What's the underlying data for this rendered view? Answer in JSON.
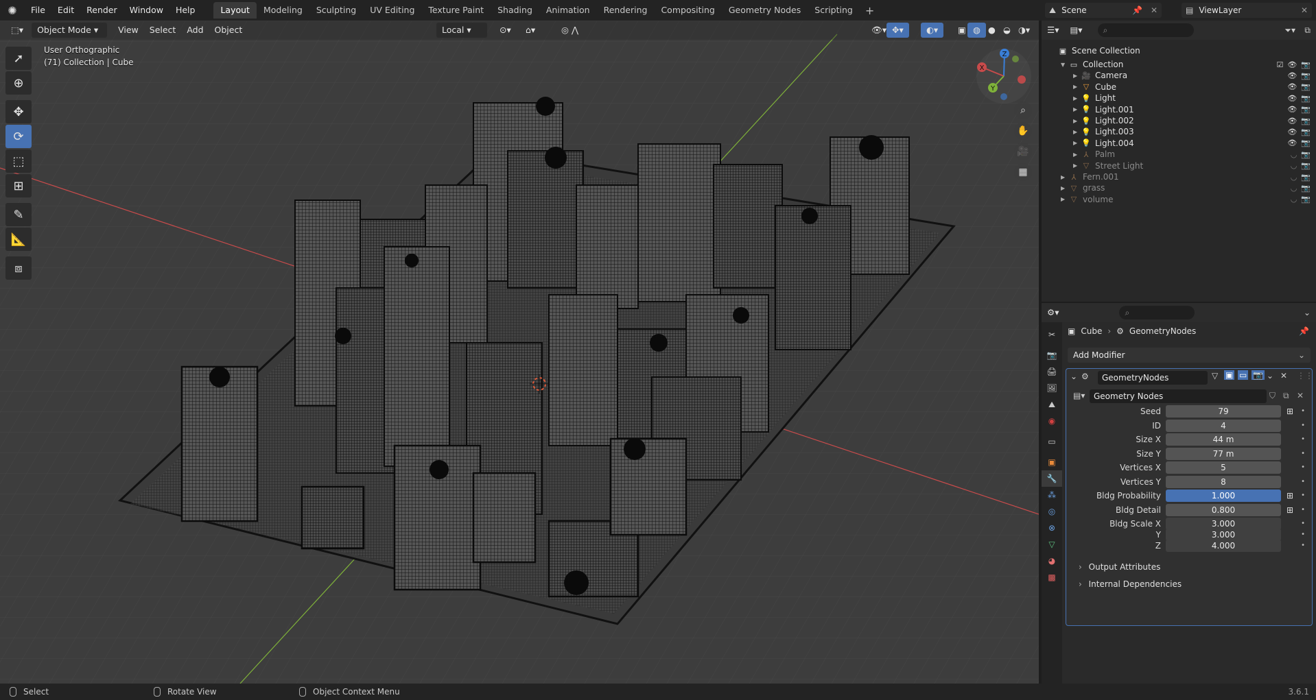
{
  "menu": {
    "items": [
      "File",
      "Edit",
      "Render",
      "Window",
      "Help"
    ]
  },
  "workspaces": {
    "tabs": [
      "Layout",
      "Modeling",
      "Sculpting",
      "UV Editing",
      "Texture Paint",
      "Shading",
      "Animation",
      "Rendering",
      "Compositing",
      "Geometry Nodes",
      "Scripting"
    ],
    "active": "Layout"
  },
  "scene": {
    "name": "Scene",
    "view_layer": "ViewLayer"
  },
  "viewport": {
    "mode": "Object Mode",
    "menus": [
      "View",
      "Select",
      "Add",
      "Object"
    ],
    "transform_orientation": "Local",
    "view_name": "User Orthographic",
    "collection_info": "(71) Collection | Cube",
    "gizmo_axes": {
      "x": "X",
      "y": "Y",
      "z": "Z"
    }
  },
  "outliner": {
    "root": "Scene Collection",
    "rows": [
      {
        "name": "Collection",
        "indent": 1,
        "icon": "collection-icon",
        "color": "#e0e0e0",
        "dim": false
      },
      {
        "name": "Camera",
        "indent": 2,
        "icon": "camera-icon",
        "color": "#e0e0e0",
        "dim": false
      },
      {
        "name": "Cube",
        "indent": 2,
        "icon": "mesh-icon",
        "color": "#e0e0e0",
        "dim": false
      },
      {
        "name": "Light",
        "indent": 2,
        "icon": "light-icon",
        "color": "#e0e0e0",
        "dim": false
      },
      {
        "name": "Light.001",
        "indent": 2,
        "icon": "light-icon",
        "color": "#e0e0e0",
        "dim": false
      },
      {
        "name": "Light.002",
        "indent": 2,
        "icon": "light-icon",
        "color": "#e0e0e0",
        "dim": false
      },
      {
        "name": "Light.003",
        "indent": 2,
        "icon": "light-icon",
        "color": "#e0e0e0",
        "dim": false
      },
      {
        "name": "Light.004",
        "indent": 2,
        "icon": "light-icon",
        "color": "#e0e0e0",
        "dim": false
      },
      {
        "name": "Palm",
        "indent": 2,
        "icon": "armature-icon",
        "color": "#8a8a8a",
        "dim": true
      },
      {
        "name": "Street Light",
        "indent": 2,
        "icon": "mesh-icon",
        "color": "#8a8a8a",
        "dim": true
      },
      {
        "name": "Fern.001",
        "indent": 1,
        "icon": "armature-icon",
        "color": "#8a8a8a",
        "dim": true
      },
      {
        "name": "grass",
        "indent": 1,
        "icon": "mesh-icon",
        "color": "#8a8a8a",
        "dim": true
      },
      {
        "name": "volume",
        "indent": 1,
        "icon": "mesh-icon",
        "color": "#8a8a8a",
        "dim": true
      }
    ]
  },
  "properties": {
    "breadcrumb": {
      "object": "Cube",
      "modifier": "GeometryNodes"
    },
    "add_modifier": "Add Modifier",
    "modifier_name": "GeometryNodes",
    "node_tree": "Geometry Nodes",
    "params": [
      {
        "label": "Seed",
        "value": "79",
        "switch": true,
        "selected": false
      },
      {
        "label": "ID",
        "value": "4",
        "switch": false,
        "selected": false
      },
      {
        "label": "Size X",
        "value": "44 m",
        "switch": false,
        "selected": false
      },
      {
        "label": "Size Y",
        "value": "77 m",
        "switch": false,
        "selected": false
      },
      {
        "label": "Vertices X",
        "value": "5",
        "switch": false,
        "selected": false
      },
      {
        "label": "Vertices Y",
        "value": "8",
        "switch": false,
        "selected": false
      },
      {
        "label": "Bldg Probability",
        "value": "1.000",
        "switch": true,
        "selected": true
      },
      {
        "label": "Bldg Detail",
        "value": "0.800",
        "switch": true,
        "selected": false
      }
    ],
    "scale": [
      {
        "label": "Bldg Scale X",
        "value": "3.000"
      },
      {
        "label": "Y",
        "value": "3.000"
      },
      {
        "label": "Z",
        "value": "4.000"
      }
    ],
    "subpanels": [
      "Output Attributes",
      "Internal Dependencies"
    ]
  },
  "statusbar": {
    "select": "Select",
    "rotate": "Rotate View",
    "context": "Object Context Menu",
    "version": "3.6.1"
  },
  "colors": {
    "accent": "#4772b3",
    "viewport_bg": "#3d3d3d",
    "axis_x": "#c84b4b",
    "axis_y": "#7fb23a",
    "axis_z": "#3a7fd8"
  }
}
